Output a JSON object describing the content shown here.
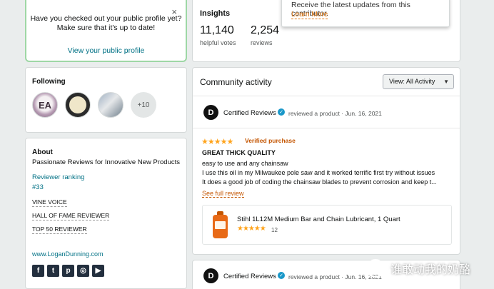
{
  "profile_prompt": {
    "message_line1": "Have you checked out your public profile yet?",
    "message_line2": "Make sure that it's up to date!",
    "view_link": "View your public profile",
    "close_glyph": "×"
  },
  "insights": {
    "title": "Insights",
    "helpful_votes_value": "11,140",
    "helpful_votes_label": "helpful votes",
    "reviews_value": "2,254",
    "reviews_label": "reviews"
  },
  "follow_popup": {
    "text": "Receive the latest updates from this contributor.",
    "learn_more": "Learn More"
  },
  "following": {
    "title": "Following",
    "avatar1_text": "EA",
    "more_count": "+10"
  },
  "about": {
    "title": "About",
    "tagline": "Passionate Reviews for Innovative New Products",
    "reviewer_ranking_label": "Reviewer ranking",
    "reviewer_ranking_value": "#33",
    "badges": [
      "VINE VOICE",
      "HALL OF FAME REVIEWER",
      "TOP 50 REVIEWER"
    ],
    "website": "www.LoganDunning.com",
    "social_icons": [
      "facebook-icon",
      "twitter-icon",
      "pinterest-icon",
      "instagram-icon",
      "youtube-icon"
    ],
    "social_glyphs": [
      "f",
      "t",
      "p",
      "◎",
      "▶"
    ]
  },
  "community_activity": {
    "title": "Community activity",
    "view_select": "View:  All Activity",
    "posts": [
      {
        "logo_letter": "D",
        "poster": "Certified Reviews",
        "action": "reviewed a product · Jun. 16, 2021",
        "stars": "★★★★★",
        "verified": "Verified purchase",
        "review_title": "GREAT THICK QUALITY",
        "body_lines": [
          "easy to use and any chainsaw",
          "I use this oil in my Milwaukee pole saw and it worked terrific first try without issues",
          "It does a good job of coding the chainsaw blades to prevent corrosion and keep t..."
        ],
        "see_full": "See full review",
        "product_name": "Stihl 1L12M Medium Bar and Chain Lubricant, 1 Quart",
        "product_rating": 5,
        "product_stars": "★★★★★",
        "product_ratings_count": "12"
      },
      {
        "logo_letter": "D",
        "poster": "Certified Reviews",
        "action": "reviewed a product · Jun. 16, 2021"
      }
    ]
  },
  "watermark": {
    "text": "谁敢动我的奶酪",
    "icon_glyph": "✿"
  },
  "colors": {
    "link": "#007185",
    "star": "#ffa41c",
    "verified": "#c45500",
    "highlight_border": "#9ed7a5",
    "learn_more": "#e47911"
  }
}
